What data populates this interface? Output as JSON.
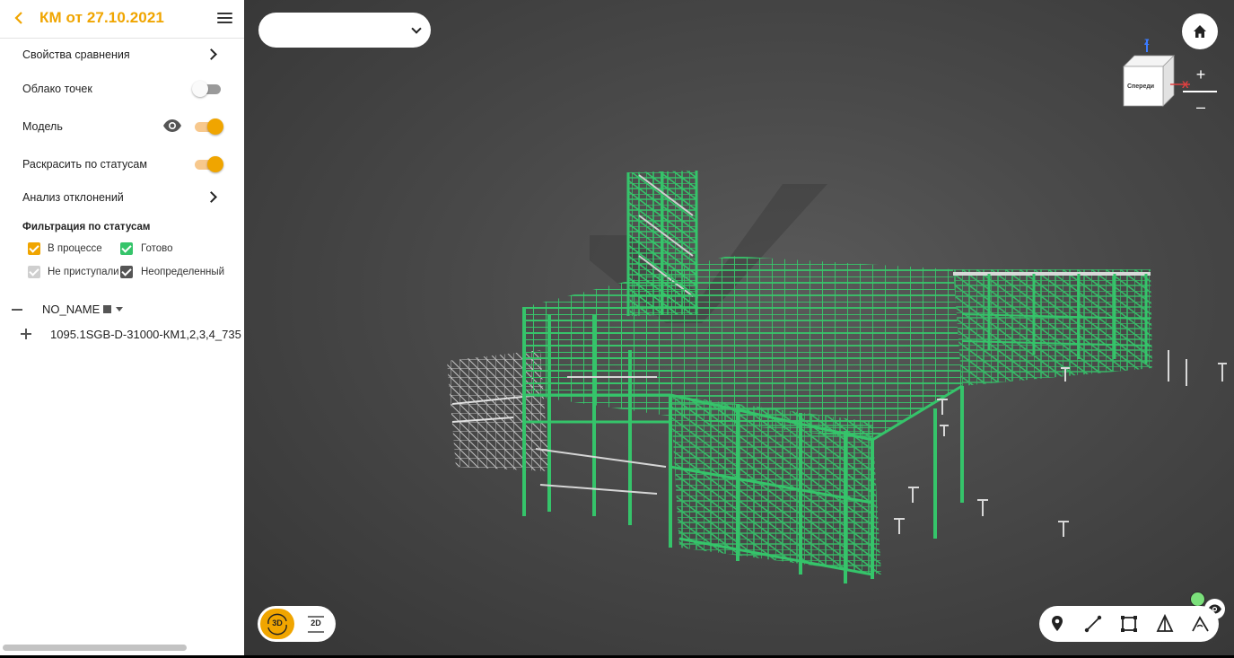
{
  "header": {
    "title": "КМ от 27.10.2021"
  },
  "sidebar": {
    "comparison_properties": "Свойства сравнения",
    "point_cloud": {
      "label": "Облако точек",
      "enabled": false
    },
    "model": {
      "label": "Модель",
      "enabled": true,
      "visible": true
    },
    "color_by_status": {
      "label": "Раскрасить по статусам",
      "enabled": true
    },
    "deviation_analysis": "Анализ отклонений",
    "status_filter": {
      "title": "Фильтрация по статусам",
      "items": [
        {
          "label": "В процессе",
          "checked": true,
          "color": "#f0a500"
        },
        {
          "label": "Готово",
          "checked": true,
          "color": "#35c46a"
        },
        {
          "label": "Не приступали",
          "checked": true,
          "color": "#cfcfcf"
        },
        {
          "label": "Неопределенный",
          "checked": true,
          "color": "#555555"
        }
      ]
    },
    "tree": {
      "root": "NO_NAME",
      "child": "1095.1SGB-D-31000-КМ1,2,3,4_735"
    }
  },
  "viewport": {
    "model_select_value": "",
    "viewcube": {
      "face": "Спереди",
      "axis_z": "Z",
      "axis_x": "X"
    },
    "zoom_in": "+",
    "zoom_out": "–",
    "modes": {
      "three_d": "3D",
      "two_d": "2D",
      "active": "3D"
    },
    "tools": [
      "marker-icon",
      "measure-distance-icon",
      "measure-area-icon",
      "section-cone-icon",
      "angle-icon"
    ]
  },
  "colors": {
    "accent": "#f0a500",
    "model_ready": "#35c46a",
    "model_untracked": "#d8d8d8",
    "viewport_bg": "#4a4a4a"
  }
}
